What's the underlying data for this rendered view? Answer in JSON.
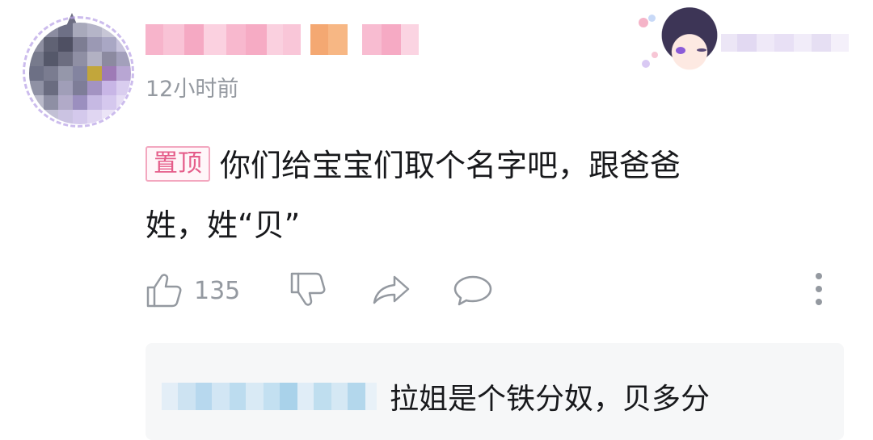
{
  "comment": {
    "time": "12小时前",
    "pin_label": "置顶",
    "text_line1": "你们给宝宝们取个名字吧，跟爸爸",
    "text_line2": "姓，姓“贝”"
  },
  "actions": {
    "like_count": "135"
  },
  "reply_preview": {
    "text": "拉姐是个铁分奴，贝多分"
  },
  "colors": {
    "pin_tag": "#e55d8a",
    "secondary_text": "#9499a0",
    "reply_bg": "#f6f7f8"
  }
}
